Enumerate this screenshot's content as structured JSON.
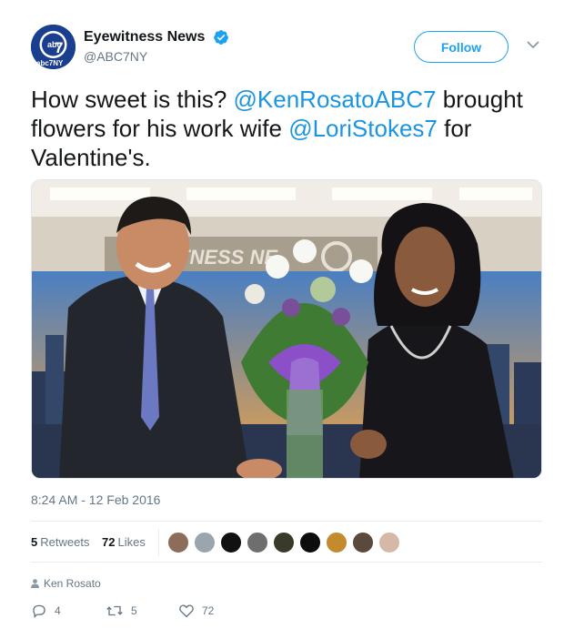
{
  "tweet": {
    "author": {
      "display_name": "Eyewitness News",
      "handle": "@ABC7NY",
      "verified": true,
      "avatar_text_top": "abc",
      "avatar_numeral": "7",
      "avatar_text_bottom": "abc7NY"
    },
    "follow_label": "Follow",
    "text": {
      "part1": "How sweet is this? ",
      "mention1": "@KenRosatoABC7",
      "part2": " brought flowers for his work wife  ",
      "mention2": "@LoriStokes7",
      "part3": " for Valentine's."
    },
    "image": {
      "alt": "Ken Rosato hands Lori Stokes a bouquet of white roses with a purple bow on the Eyewitness News set",
      "set_sign": "TNESS NE"
    },
    "timestamp": "8:24 AM - 12 Feb 2016",
    "stats": {
      "retweets_count": "5",
      "retweets_label": "Retweets",
      "likes_count": "72",
      "likes_label": "Likes"
    },
    "likers": [
      {
        "color": "#8c6d5a"
      },
      {
        "color": "#9aa5ae"
      },
      {
        "color": "#111111"
      },
      {
        "color": "#6e6e6e"
      },
      {
        "color": "#3a3a2a"
      },
      {
        "color": "#0d0d0d"
      },
      {
        "color": "#c48a2e"
      },
      {
        "color": "#5b4a3c"
      },
      {
        "color": "#d6b8a8"
      }
    ],
    "retweeted_by": "Ken Rosato",
    "actions": {
      "reply_count": "4",
      "retweet_count": "5",
      "like_count": "72"
    }
  },
  "colors": {
    "accent": "#1da1f2",
    "mention": "#1b95e0",
    "muted": "#657786"
  }
}
